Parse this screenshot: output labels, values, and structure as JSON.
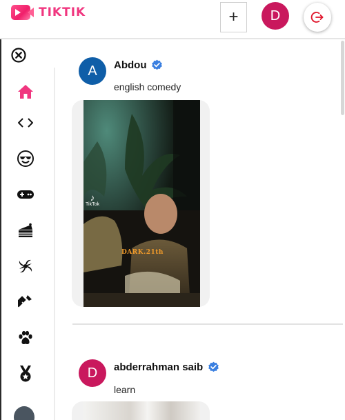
{
  "header": {
    "logo_text": "TIKTIK",
    "upload_label": "+",
    "user_initial": "D",
    "accent_color": "#f0367f"
  },
  "sidebar": {
    "close_icon": "close-circle-icon",
    "topics": [
      {
        "icon": "home-icon",
        "active": true
      },
      {
        "icon": "code-icon"
      },
      {
        "icon": "sunglasses-face-icon"
      },
      {
        "icon": "gamepad-icon"
      },
      {
        "icon": "cake-icon"
      },
      {
        "icon": "dance-icon"
      },
      {
        "icon": "lipstick-icon"
      },
      {
        "icon": "paw-icon"
      },
      {
        "icon": "medal-icon"
      }
    ]
  },
  "feed": {
    "posts": [
      {
        "initial": "A",
        "avatar_color": "#0f5ea8",
        "username": "Abdou",
        "verified": true,
        "caption": "english comedy",
        "video": {
          "platform_watermark": "TikTok",
          "overlay_text": "DARK.21th"
        }
      },
      {
        "initial": "D",
        "avatar_color": "#c9185d",
        "username": "abderrahman saib",
        "verified": true,
        "caption": "learn"
      }
    ]
  }
}
